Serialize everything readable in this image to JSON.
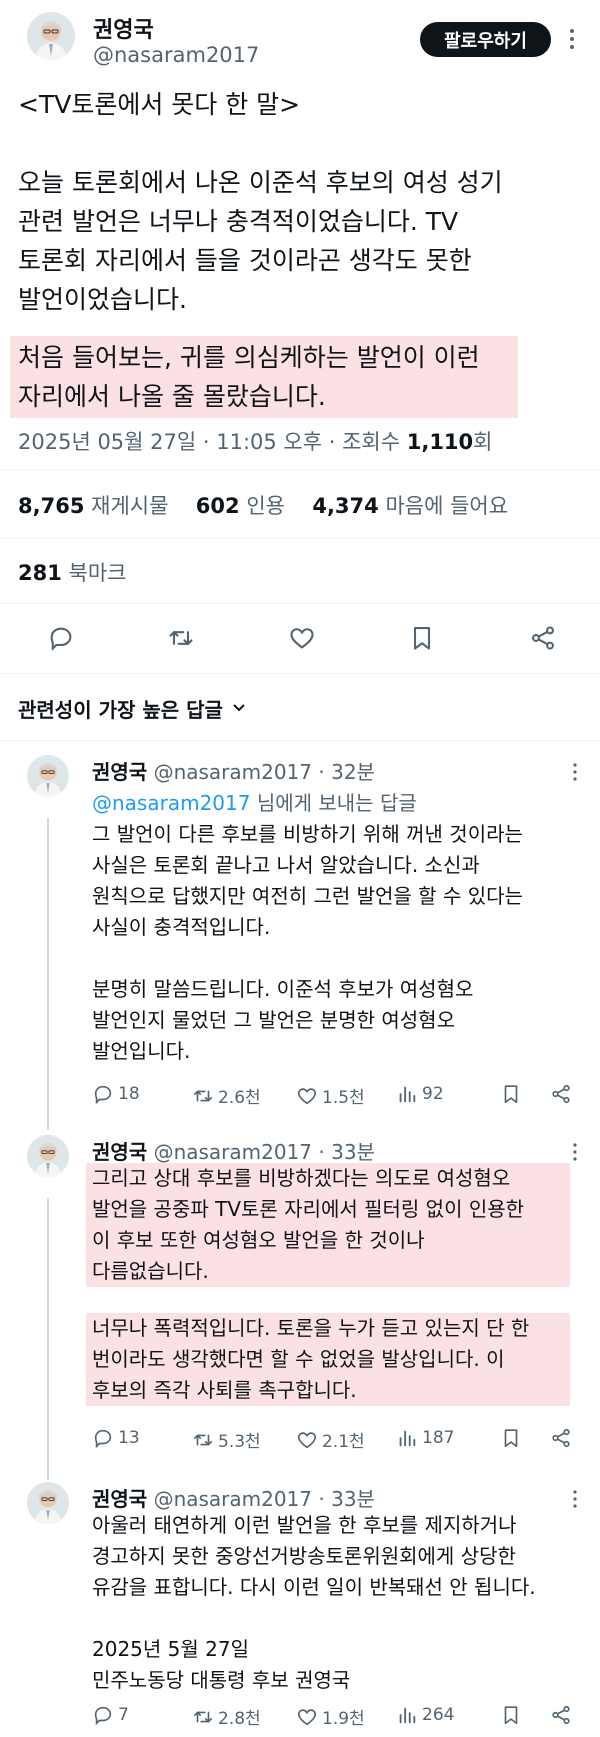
{
  "author": {
    "name": "권영국",
    "handle": "@nasaram2017",
    "follow_label": "팔로우하기"
  },
  "tweet": {
    "lines": [
      "<TV토론에서 못다 한 말>",
      "",
      "오늘 토론회에서 나온 이준석 후보의 여성 성기",
      "관련 발언은 너무나 충격적이었습니다. TV",
      "토론회 자리에서 들을 것이라곤 생각도 못한",
      "발언이었습니다."
    ],
    "highlight_lines": [
      "처음 들어보는, 귀를 의심케하는 발언이 이런",
      "자리에서 나올 줄 몰랐습니다."
    ],
    "meta_date": "2025년 05월 27일 · 11:05 오후 · 조회수",
    "meta_views": "1,110",
    "meta_views_unit": "회"
  },
  "stats": {
    "retweets": "8,765",
    "retweets_label": "재게시물",
    "quotes": "602",
    "quotes_label": "인용",
    "likes": "4,374",
    "likes_label": "마음에 들어요",
    "bookmarks": "281",
    "bookmarks_label": "북마크"
  },
  "replies_header": "관련성이 가장 높은 답글",
  "replies": [
    {
      "name": "권영국",
      "handle": "@nasaram2017",
      "time": "· 32분",
      "reply_to_handle": "@nasaram2017",
      "reply_to_suffix": " 님에게 보내는 답글",
      "lines": [
        "그 발언이 다른 후보를 비방하기 위해 꺼낸 것이라는",
        "사실은 토론회 끝나고 나서 알았습니다. 소신과",
        "원칙으로 답했지만 여전히 그런 발언을 할 수 있다는",
        "사실이 충격적입니다.",
        "",
        "분명히 말씀드립니다. 이준석 후보가 여성혐오",
        "발언인지 물었던 그 발언은 분명한 여성혐오",
        "발언입니다."
      ],
      "comments": "18",
      "retweets": "2.6천",
      "likes": "1.5천",
      "views": "92"
    },
    {
      "name": "권영국",
      "handle": "@nasaram2017",
      "time": "· 33분",
      "highlight_a": [
        "그리고 상대 후보를 비방하겠다는 의도로 여성혐오",
        "발언을 공중파 TV토론 자리에서 필터링 없이 인용한",
        "이 후보 또한 여성혐오 발언을 한 것이나",
        "다름없습니다."
      ],
      "highlight_b": [
        "너무나 폭력적입니다. 토론을 누가 듣고 있는지 단 한",
        "번이라도 생각했다면 할 수 없었을 발상입니다. 이",
        "후보의 즉각 사퇴를 촉구합니다."
      ],
      "comments": "13",
      "retweets": "5.3천",
      "likes": "2.1천",
      "views": "187"
    },
    {
      "name": "권영국",
      "handle": "@nasaram2017",
      "time": "· 33분",
      "lines": [
        "아울러 태연하게 이런 발언을 한 후보를 제지하거나",
        "경고하지 못한 중앙선거방송토론위원회에게 상당한",
        "유감을 표합니다. 다시 이런 일이 반복돼선 안 됩니다.",
        "",
        "2025년 5월 27일",
        "민주노동당 대통령 후보 권영국"
      ],
      "comments": "7",
      "retweets": "2.8천",
      "likes": "1.9천",
      "views": "264"
    }
  ],
  "colors": {
    "text": "#0f1419",
    "secondary": "#536471",
    "link": "#1d9bf0",
    "highlight": "#fbe0e4"
  },
  "icons": [
    "more-icon",
    "comment-icon",
    "retweet-icon",
    "like-icon",
    "bookmark-icon",
    "share-icon",
    "views-icon",
    "chevron-down-icon"
  ]
}
